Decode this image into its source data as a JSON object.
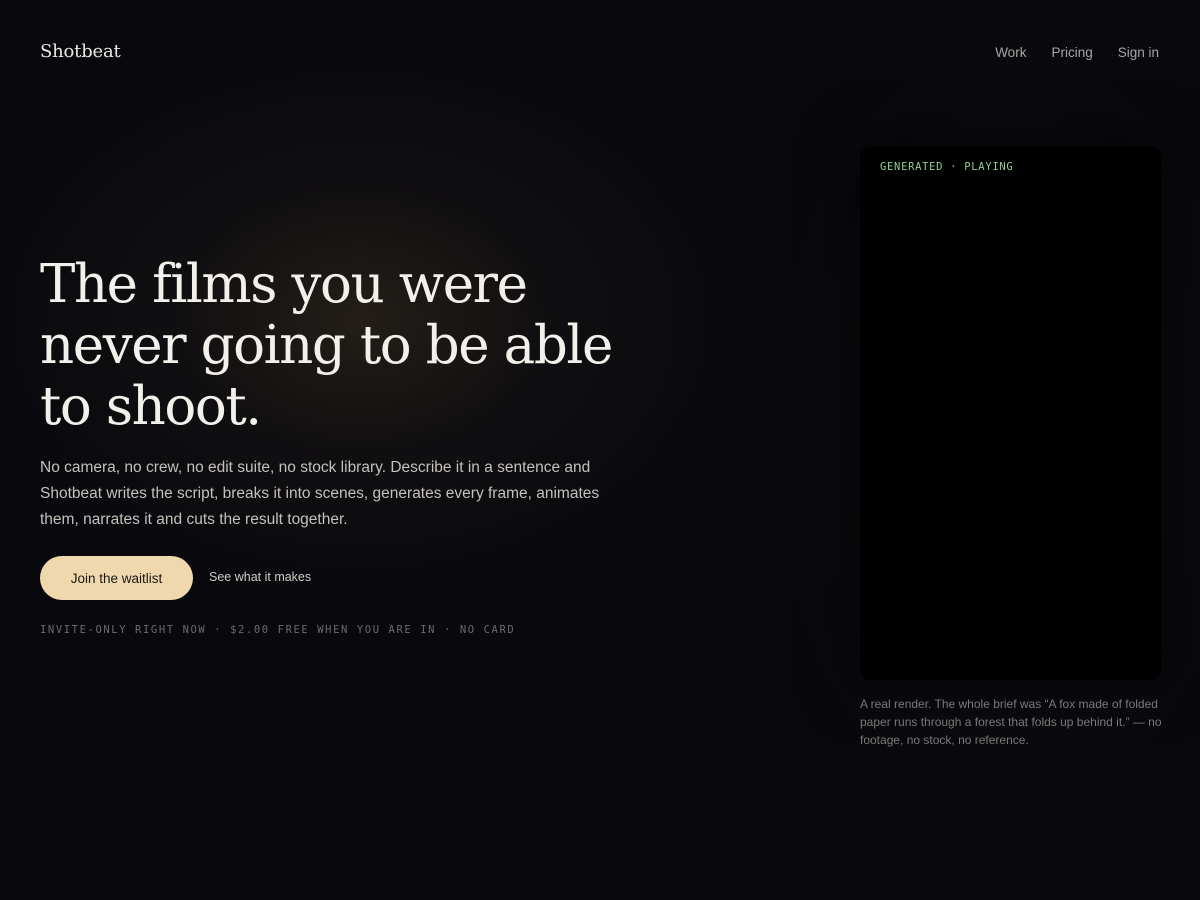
{
  "brand": {
    "name": "Shotbeat"
  },
  "nav": {
    "items": [
      {
        "label": "Work"
      },
      {
        "label": "Pricing"
      },
      {
        "label": "Sign in"
      }
    ]
  },
  "hero": {
    "headline": "The films you were never going to be able to shoot.",
    "lede": "No camera, no crew, no edit suite, no stock library. Describe it in a sentence and Shotbeat writes the script, breaks it into scenes, generates every frame, animates them, narrates it and cuts the result together.",
    "primary_cta": "Join the waitlist",
    "secondary_cta": "See what it makes",
    "fineprint": "INVITE-ONLY RIGHT NOW · $2.00 FREE WHEN YOU ARE IN · NO CARD"
  },
  "player": {
    "status": "GENERATED · PLAYING",
    "caption": "A real render. The whole brief was “A fox made of folded paper runs through a forest that folds up behind it.” — no footage, no stock, no reference."
  },
  "colors": {
    "background": "#08080d",
    "accent_button": "#efd8ad",
    "status_green": "#8fcf8e"
  }
}
